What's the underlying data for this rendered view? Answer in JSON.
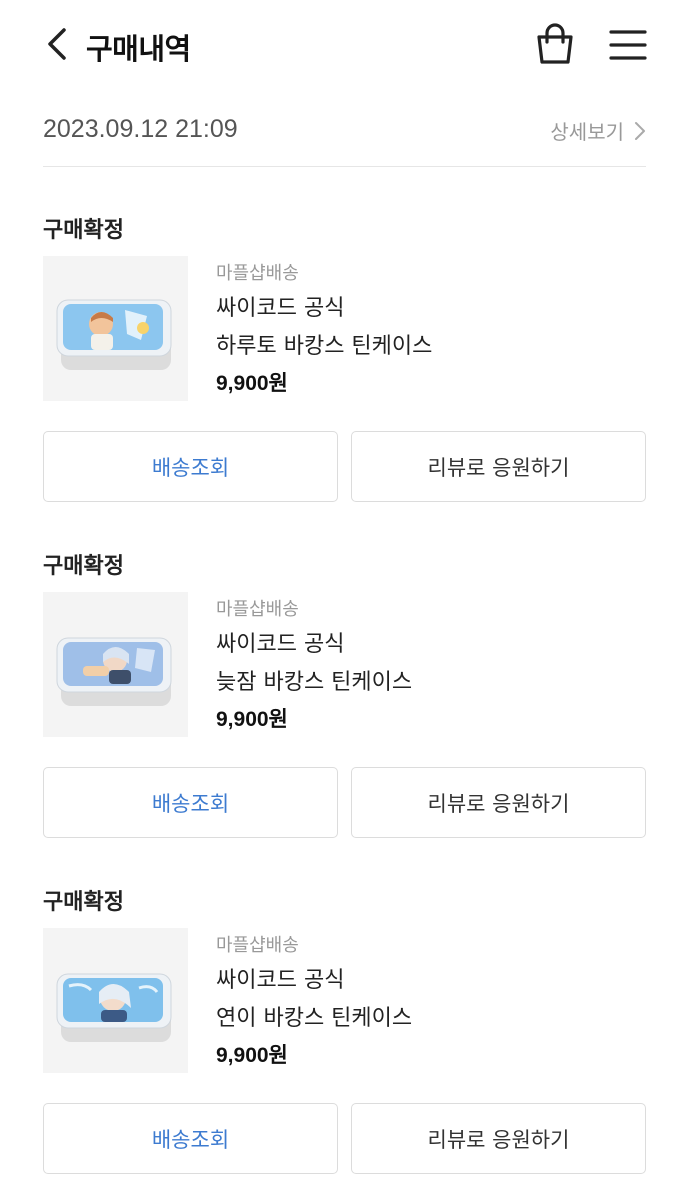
{
  "header": {
    "title": "구매내역"
  },
  "order": {
    "date": "2023.09.12 21:09",
    "detail_label": "상세보기"
  },
  "items": [
    {
      "status": "구매확정",
      "seller": "마플샵배송",
      "brand": "싸이코드 공식",
      "name": "하루토 바캉스 틴케이스",
      "price": "9,900원",
      "track_label": "배송조회",
      "review_label": "리뷰로 응원하기"
    },
    {
      "status": "구매확정",
      "seller": "마플샵배송",
      "brand": "싸이코드 공식",
      "name": "늦잠 바캉스 틴케이스",
      "price": "9,900원",
      "track_label": "배송조회",
      "review_label": "리뷰로 응원하기"
    },
    {
      "status": "구매확정",
      "seller": "마플샵배송",
      "brand": "싸이코드 공식",
      "name": "연이 바캉스 틴케이스",
      "price": "9,900원",
      "track_label": "배송조회",
      "review_label": "리뷰로 응원하기"
    }
  ],
  "colors": {
    "accent": "#3d7bd0",
    "muted": "#999999",
    "border": "#dcdcdc"
  },
  "icons": [
    "chevron-left-icon",
    "shopping-bag-icon",
    "hamburger-menu-icon",
    "chevron-right-icon"
  ]
}
